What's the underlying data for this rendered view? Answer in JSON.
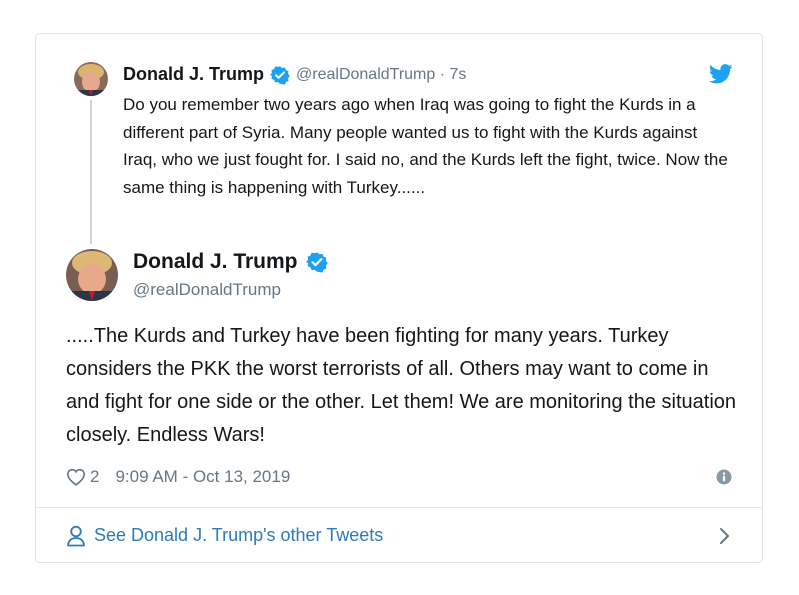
{
  "parent_tweet": {
    "name": "Donald J. Trump",
    "handle_time": "@realDonaldTrump · 7s",
    "text": "Do you remember two years ago when Iraq was going to fight the Kurds in a different part of Syria. Many people wanted us to fight with the Kurds against Iraq, who we just fought for. I said no, and the Kurds left the fight, twice. Now the same thing is happening with Turkey......",
    "avatar_icon": "avatar-photo",
    "verified_icon": "verified-badge-icon"
  },
  "main_tweet": {
    "name": "Donald J. Trump",
    "handle": "@realDonaldTrump",
    "text": ".....The Kurds and Turkey have been fighting for many years. Turkey considers the PKK the worst terrorists of all. Others may want to come in and fight for one side or the other. Let them! We are monitoring the situation closely. Endless Wars!",
    "likes": "2",
    "timestamp": "9:09 AM - Oct 13, 2019",
    "avatar_icon": "avatar-photo",
    "verified_icon": "verified-badge-icon"
  },
  "footer": {
    "link_label": "See Donald J. Trump's other Tweets",
    "person_icon": "person-icon",
    "chevron_icon": "chevron-right-icon"
  },
  "icons": {
    "twitter_logo": "twitter-bird-icon",
    "heart": "heart-icon",
    "info": "info-icon"
  },
  "colors": {
    "verified_blue": "#1da1f2",
    "link_blue": "#2b7bb9",
    "secondary_text": "#657786",
    "primary_text": "#14171a",
    "border": "#dfe3e8"
  }
}
